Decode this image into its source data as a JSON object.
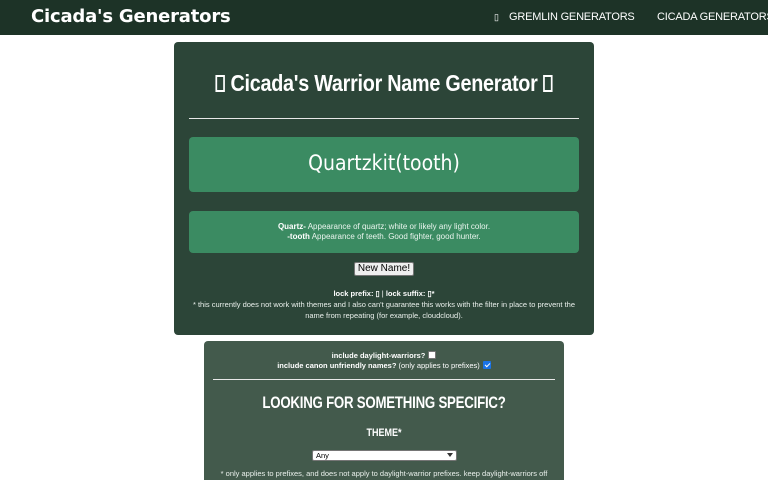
{
  "nav": {
    "brand": "Cicada's Generators",
    "links": [
      {
        "icon": "box-icon",
        "label": "GREMLIN GENERATORS"
      },
      {
        "label": "CICADA GENERATORS"
      }
    ]
  },
  "generator": {
    "title": "Cicada's Warrior Name Generator",
    "name": "Quartzkit(tooth)",
    "meaning": {
      "prefix_term": "Quartz-",
      "prefix_desc": " Appearance of quartz; white or likely any light color.",
      "suffix_term": "-tooth",
      "suffix_desc": " Appearance of teeth. Good fighter, good hunter."
    },
    "button_label": "New Name!",
    "lock_prefix_label": "lock prefix: ",
    "lock_sep": " | ",
    "lock_suffix_label": "lock suffix: ",
    "note": "* this currently does not work with themes and I also can't guarantee this works with the filter in place to prevent the name from repeating (for example, cloudcloud)."
  },
  "options": {
    "daylight_label": "include daylight-warriors?",
    "daylight_checked": false,
    "canon_label": "include canon unfriendly names?",
    "canon_note": " (only applies to prefixes)",
    "canon_checked": true,
    "specific_title": "LOOKING FOR SOMETHING SPECIFIC?",
    "theme_label": "THEME*",
    "theme_selected": "Any",
    "note": "* only applies to prefixes, and does not apply to daylight-warrior prefixes. keep daylight-warriors off"
  }
}
